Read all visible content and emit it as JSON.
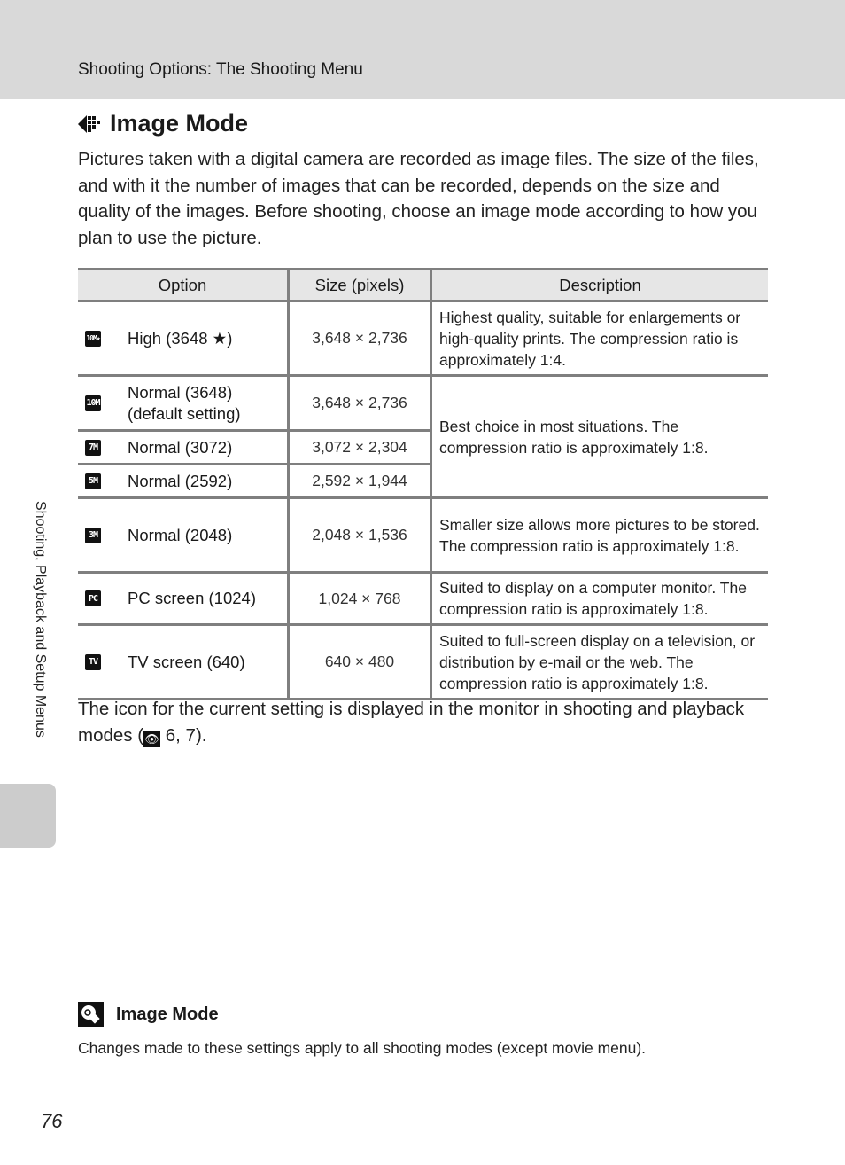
{
  "header": {
    "title": "Shooting Options: The Shooting Menu"
  },
  "section": {
    "icon": "image-mode-icon",
    "title": "Image Mode",
    "intro": "Pictures taken with a digital camera are recorded as image files. The size of the files, and with it the number of images that can be recorded, depends on the size and quality of the images. Before shooting, choose an image mode according to how you plan to use the picture."
  },
  "table": {
    "headers": [
      "Option",
      "Size (pixels)",
      "Description"
    ],
    "rows": [
      {
        "icon": "10M★",
        "icon_name": "high-3648-icon",
        "option": "High (3648 ★)",
        "size": "3,648 × 2,736",
        "description": "Highest quality, suitable for enlargements or high-quality prints. The compression ratio is approximately 1:4."
      },
      {
        "icon": "10M",
        "icon_name": "normal-3648-icon",
        "option": "Normal (3648) (default setting)",
        "size": "3,648 × 2,736",
        "description": "Best choice in most situations. The compression ratio is approximately 1:8."
      },
      {
        "icon": "7M",
        "icon_name": "normal-3072-icon",
        "option": "Normal (3072)",
        "size": "3,072 × 2,304"
      },
      {
        "icon": "5M",
        "icon_name": "normal-2592-icon",
        "option": "Normal (2592)",
        "size": "2,592 × 1,944"
      },
      {
        "icon": "3M",
        "icon_name": "normal-2048-icon",
        "option": "Normal (2048)",
        "size": "2,048 × 1,536",
        "description": "Smaller size allows more pictures to be stored. The compression ratio is approximately 1:8."
      },
      {
        "icon": "PC",
        "icon_name": "pc-screen-icon",
        "option": "PC screen (1024)",
        "size": "1,024 × 768",
        "description": "Suited to display on a computer monitor. The compression ratio is approximately 1:8."
      },
      {
        "icon": "TV",
        "icon_name": "tv-screen-icon",
        "option": "TV screen (640)",
        "size": "640 × 480",
        "description": "Suited to full-screen display on a television, or distribution by e-mail or the web. The compression ratio is approximately 1:8."
      }
    ]
  },
  "after_table": {
    "text_before": "The icon for the current setting is displayed in the monitor in shooting and playback modes (",
    "ref_icon": "eye-reference-icon",
    "text_after": " 6, 7)."
  },
  "side_label": "Shooting, Playback and Setup Menus",
  "note": {
    "icon": "lightbulb-note-icon",
    "title": "Image Mode",
    "body": "Changes made to these settings apply to all shooting modes (except movie menu)."
  },
  "page_number": "76"
}
